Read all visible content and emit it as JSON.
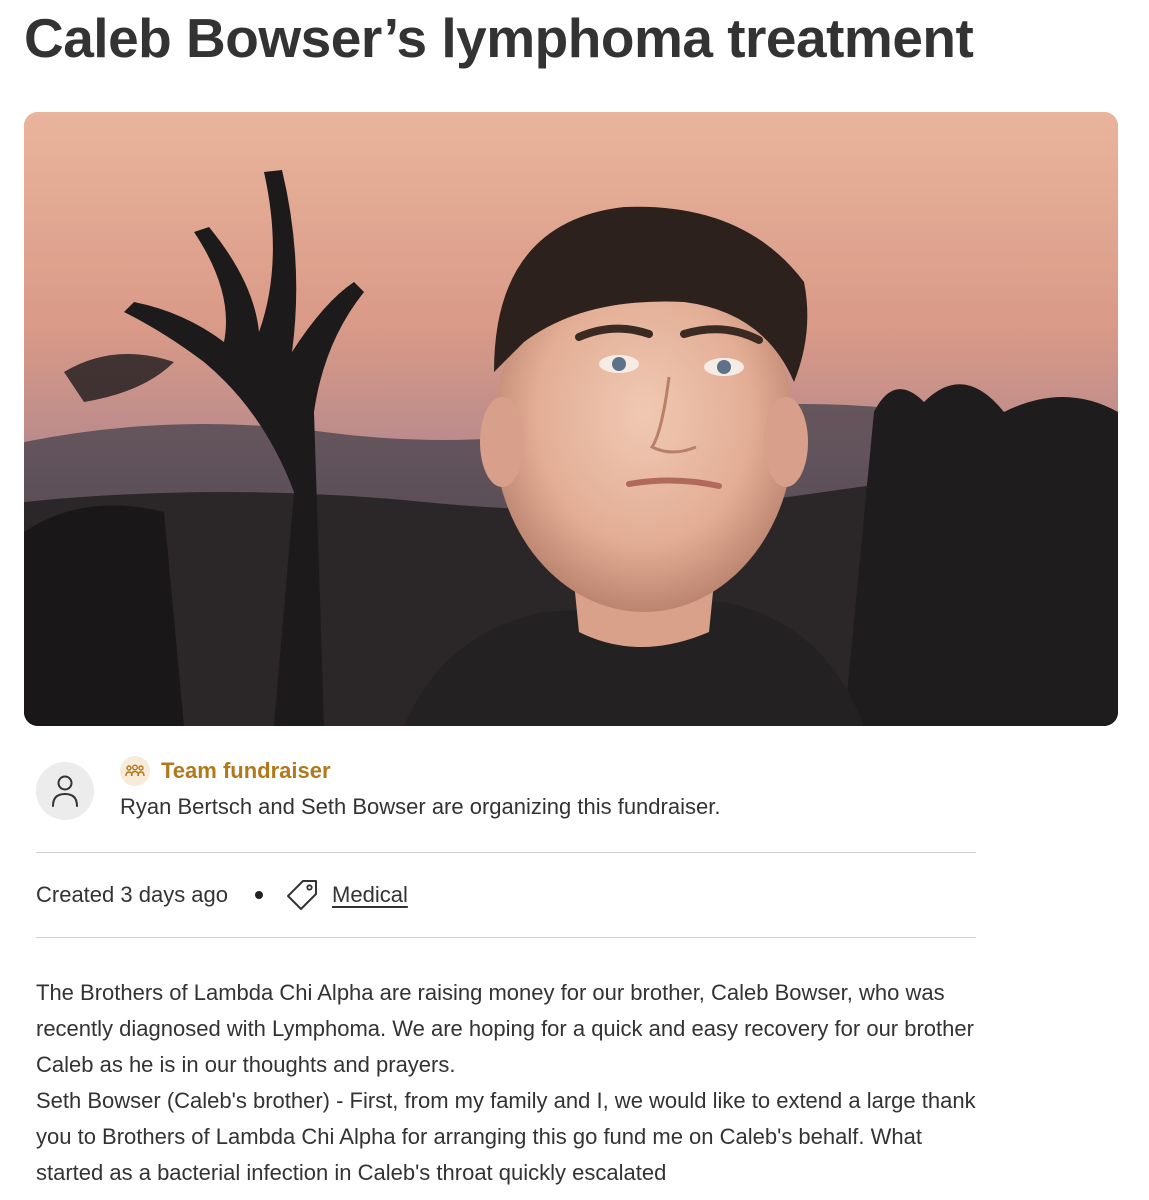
{
  "campaign": {
    "title": "Caleb Bowser’s lymphoma treatment"
  },
  "hero": {
    "alt": "Photo of Caleb Bowser at sunset"
  },
  "organizer": {
    "team_label": "Team fundraiser",
    "text": "Ryan Bertsch and Seth Bowser are organizing this fundraiser."
  },
  "meta": {
    "created": "Created 3 days ago",
    "category": "Medical"
  },
  "story": {
    "paragraphs": [
      "The Brothers of Lambda Chi Alpha are raising money for our brother, Caleb Bowser, who was recently diagnosed with Lymphoma. We are hoping for a quick and easy recovery for our brother Caleb as he is in our thoughts and prayers.",
      "Seth Bowser (Caleb's brother) - First, from my family and I, we would like to extend a large thank you to Brothers of Lambda Chi Alpha for arranging this go fund me on Caleb's behalf. What started as a bacterial infection in Caleb's throat quickly escalated"
    ]
  },
  "colors": {
    "accent": "#b2781c",
    "text": "#333333",
    "divider": "#cfcfcf"
  },
  "icons": {
    "team": "people-group-icon",
    "avatar": "user-icon",
    "category": "tag-icon"
  }
}
